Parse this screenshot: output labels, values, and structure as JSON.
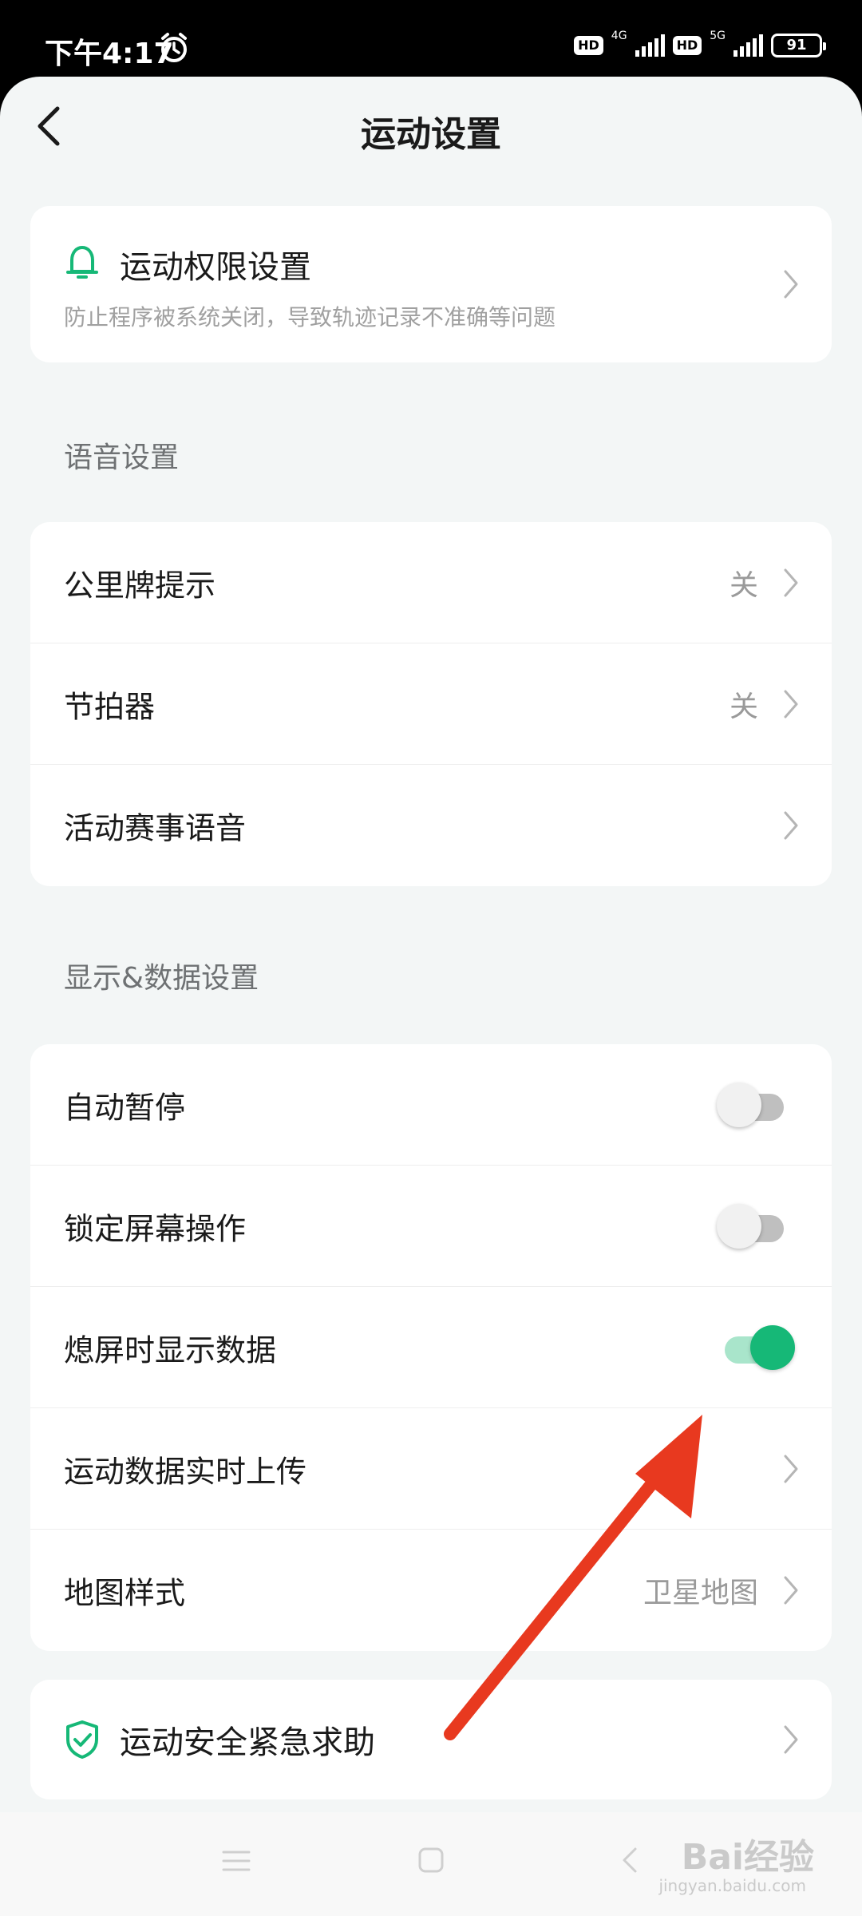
{
  "status_bar": {
    "time": "下午4:17",
    "hd1": "HD",
    "net1": "4G",
    "hd2": "HD",
    "net2": "5G",
    "battery": "91"
  },
  "header": {
    "title": "运动设置"
  },
  "permission": {
    "title": "运动权限设置",
    "subtitle": "防止程序被系统关闭，导致轨迹记录不准确等问题",
    "icon": "bell-icon"
  },
  "voice_section": {
    "title": "语音设置",
    "items": [
      {
        "label": "公里牌提示",
        "value": "关"
      },
      {
        "label": "节拍器",
        "value": "关"
      },
      {
        "label": "活动赛事语音",
        "value": ""
      }
    ]
  },
  "display_section": {
    "title": "显示&数据设置",
    "items": [
      {
        "label": "自动暂停",
        "toggle": false
      },
      {
        "label": "锁定屏幕操作",
        "toggle": false
      },
      {
        "label": "熄屏时显示数据",
        "toggle": true
      },
      {
        "label": "运动数据实时上传",
        "value": ""
      },
      {
        "label": "地图样式",
        "value": "卫星地图"
      }
    ]
  },
  "safety": {
    "label": "运动安全紧急求助",
    "icon": "shield-check-icon"
  },
  "colors": {
    "accent": "#16b877",
    "background": "#f3f6f6",
    "annotation_arrow": "#e8391f"
  },
  "watermark": {
    "brand": "Bai经验",
    "url": "jingyan.baidu.com"
  }
}
